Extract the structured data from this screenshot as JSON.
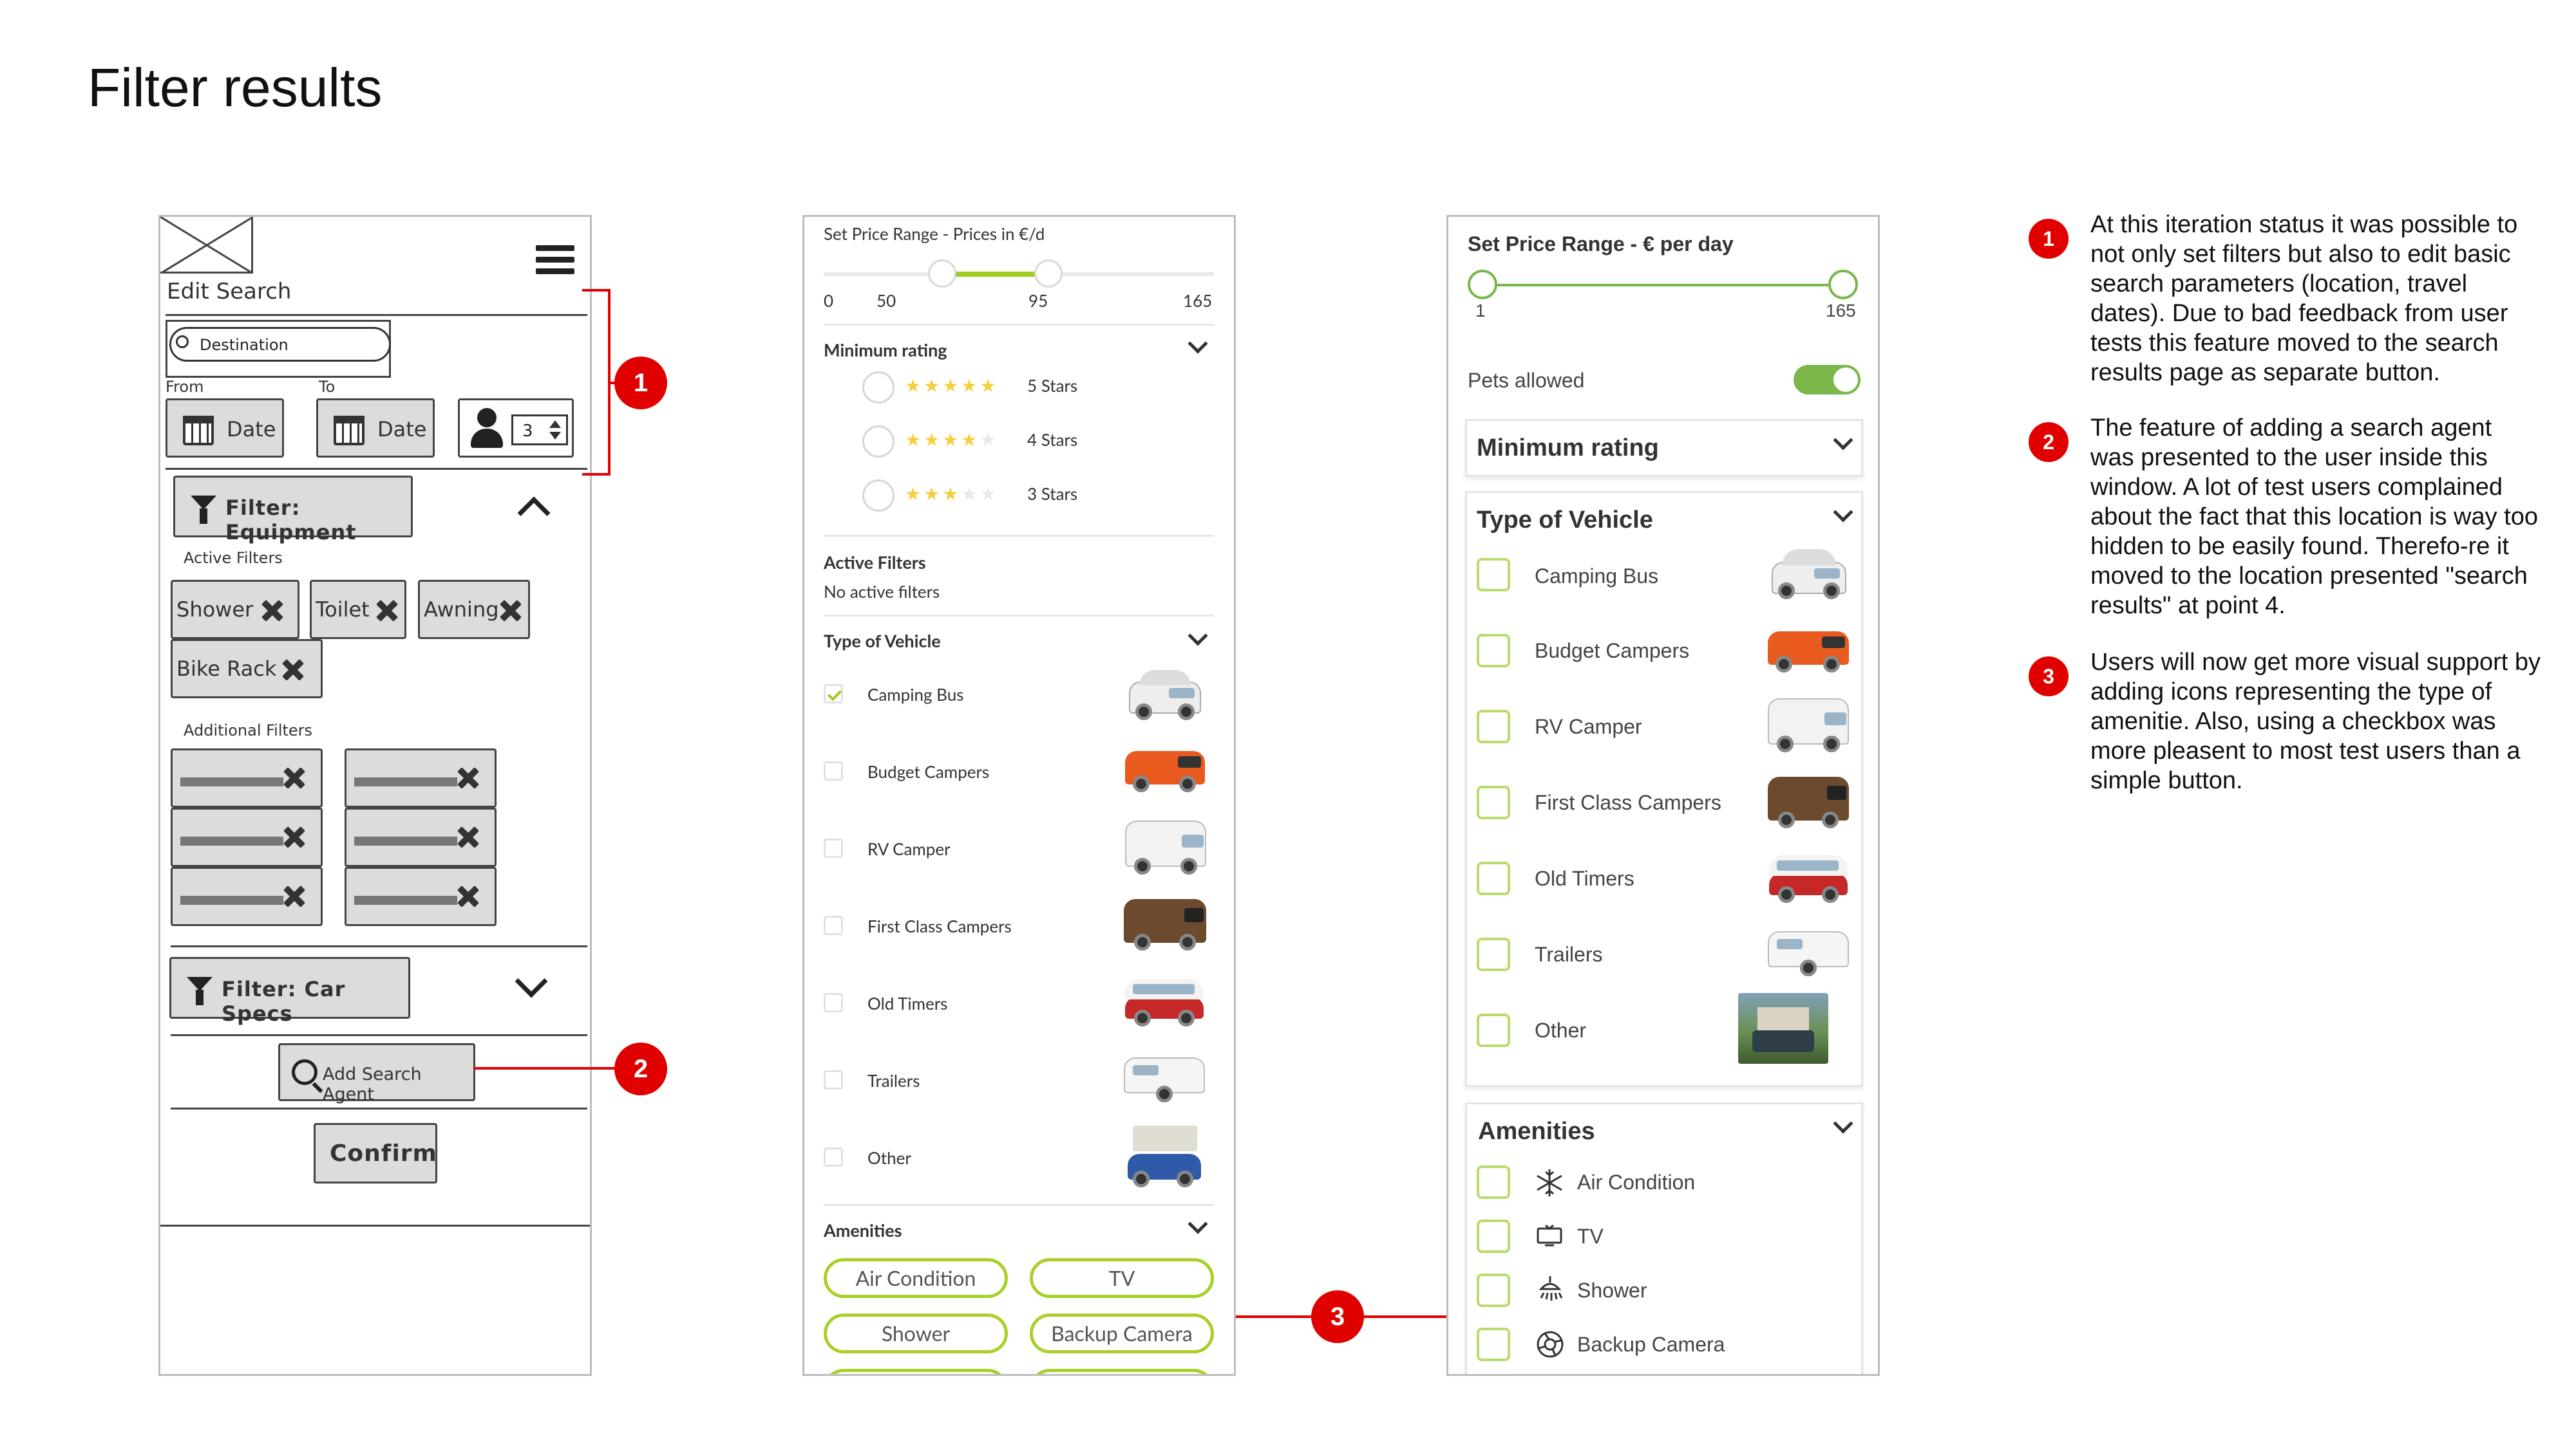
{
  "page": {
    "title": "Filter results"
  },
  "wireframe": {
    "edit_search": "Edit Search",
    "destination_placeholder": "Destination",
    "from_label": "From",
    "to_label": "To",
    "date_label": "Date",
    "guests": "3",
    "filter_equipment": "Filter: Equipment",
    "active_filters": "Active Filters",
    "chips": [
      "Shower",
      "Toilet",
      "Awning",
      "Bike Rack"
    ],
    "additional_filters": "Additional Filters",
    "filter_car_specs": "Filter: Car Specs",
    "add_search_agent": "Add Search Agent",
    "confirm": "Confirm"
  },
  "v2": {
    "price_title": "Set Price Range - Prices in €/d",
    "price_ticks": [
      "0",
      "50",
      "95",
      "165"
    ],
    "price_range": [
      50,
      95
    ],
    "price_max": 165,
    "min_rating": "Minimum rating",
    "ratings": [
      {
        "label": "5 Stars",
        "stars": 5
      },
      {
        "label": "4 Stars",
        "stars": 4
      },
      {
        "label": "3 Stars",
        "stars": 3
      }
    ],
    "active_filters": "Active Filters",
    "no_active": "No active filters",
    "type_of_vehicle": "Type of Vehicle",
    "vehicles": [
      {
        "label": "Camping Bus",
        "checked": true
      },
      {
        "label": "Budget Campers",
        "checked": false
      },
      {
        "label": "RV Camper",
        "checked": false
      },
      {
        "label": "First Class Campers",
        "checked": false
      },
      {
        "label": "Old Timers",
        "checked": false
      },
      {
        "label": "Trailers",
        "checked": false
      },
      {
        "label": "Other",
        "checked": false
      }
    ],
    "amenities": "Amenities",
    "amenity_buttons": [
      "Air Condition",
      "TV",
      "Shower",
      "Backup Camera"
    ]
  },
  "v3": {
    "price_title": "Set Price Range - € per day",
    "price_min": "1",
    "price_max": "165",
    "pets_allowed": "Pets allowed",
    "pets_allowed_on": true,
    "min_rating": "Minimum rating",
    "type_of_vehicle": "Type of Vehicle",
    "vehicles": [
      "Camping Bus",
      "Budget Campers",
      "RV Camper",
      "First Class Campers",
      "Old Timers",
      "Trailers",
      "Other"
    ],
    "amenities": "Amenities",
    "amenity_list": [
      {
        "label": "Air Condition",
        "icon": "snowflake-icon"
      },
      {
        "label": "TV",
        "icon": "tv-icon"
      },
      {
        "label": "Shower",
        "icon": "shower-icon"
      },
      {
        "label": "Backup Camera",
        "icon": "camera-icon"
      }
    ]
  },
  "callouts": [
    "1",
    "2",
    "3"
  ],
  "notes": [
    {
      "num": "1",
      "text": "At this iteration status it was possible to not only set filters but also to edit basic search parameters (location, travel dates). Due to bad feedback from user tests this feature moved to the search results page as separate button."
    },
    {
      "num": "2",
      "text": "The feature of adding a search agent was presented to the user inside this window. A lot of test users complained about the fact that this location is way too hidden to be easily found. Therefo-re it moved to the location presented \"search results\" at point 4."
    },
    {
      "num": "3",
      "text": "Users will now get more visual support by adding icons representing the type of amenitie. Also, using a checkbox was more pleasent to most test users than a simple button."
    }
  ],
  "colors": {
    "accent_green": "#9fce1f",
    "callout_red": "#e00000"
  }
}
